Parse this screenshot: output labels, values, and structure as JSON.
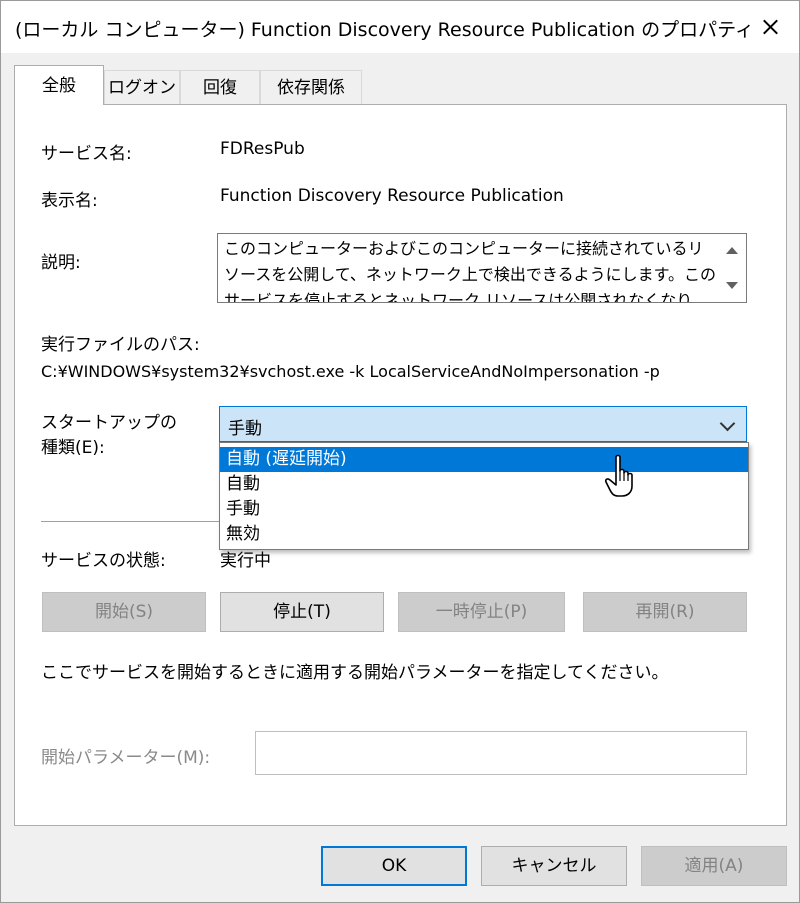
{
  "window": {
    "title": "(ローカル コンピューター) Function Discovery Resource Publication のプロパティ"
  },
  "tabs": [
    {
      "label": "全般",
      "active": true
    },
    {
      "label": "ログオン",
      "active": false
    },
    {
      "label": "回復",
      "active": false
    },
    {
      "label": "依存関係",
      "active": false
    }
  ],
  "general": {
    "service_name_label": "サービス名:",
    "service_name": "FDResPub",
    "display_name_label": "表示名:",
    "display_name": "Function Discovery Resource Publication",
    "description_label": "説明:",
    "description": "このコンピューターおよびこのコンピューターに接続されているリソースを公開して、ネットワーク上で検出できるようにします。このサービスを停止するとネットワーク リソースは公開されなくなり",
    "exe_path_label": "実行ファイルのパス:",
    "exe_path": "C:¥WINDOWS¥system32¥svchost.exe -k LocalServiceAndNoImpersonation -p",
    "startup_type_label_1": "スタートアップの",
    "startup_type_label_2": "種類(E):",
    "startup_type_selected": "手動",
    "startup_options": [
      "自動 (遅延開始)",
      "自動",
      "手動",
      "無効"
    ],
    "highlighted_option_index": 0,
    "status_label": "サービスの状態:",
    "status_value": "実行中",
    "buttons": {
      "start": "開始(S)",
      "stop": "停止(T)",
      "pause": "一時停止(P)",
      "resume": "再開(R)"
    },
    "param_hint": "ここでサービスを開始するときに適用する開始パラメーターを指定してください。",
    "param_label": "開始パラメーター(M):",
    "param_value": ""
  },
  "footer": {
    "ok": "OK",
    "cancel": "キャンセル",
    "apply": "適用(A)"
  },
  "colors": {
    "accent": "#0078d7",
    "combo_bg": "#cce4f7",
    "disabled_text": "#838383"
  }
}
